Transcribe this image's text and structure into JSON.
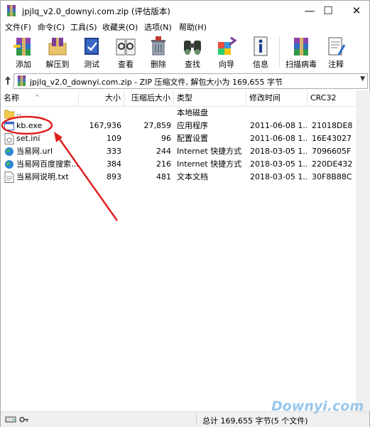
{
  "window": {
    "title": "jpjlq_v2.0_downyi.com.zip (评估版本)"
  },
  "menu": [
    "文件(F)",
    "命令(C)",
    "工具(S)",
    "收藏夹(O)",
    "选项(N)",
    "帮助(H)"
  ],
  "toolbar": [
    {
      "label": "添加",
      "icon": "add-archive-icon"
    },
    {
      "label": "解压到",
      "icon": "extract-to-icon"
    },
    {
      "label": "测试",
      "icon": "test-icon"
    },
    {
      "label": "查看",
      "icon": "view-icon"
    },
    {
      "label": "删除",
      "icon": "delete-icon"
    },
    {
      "label": "查找",
      "icon": "find-icon"
    },
    {
      "label": "向导",
      "icon": "wizard-icon"
    },
    {
      "label": "信息",
      "icon": "info-icon"
    },
    {
      "label": "扫描病毒",
      "icon": "scan-virus-icon"
    },
    {
      "label": "注释",
      "icon": "comment-icon"
    }
  ],
  "address": {
    "text": "jpjlq_v2.0_downyi.com.zip - ZIP 压缩文件, 解包大小为 169,655 字节"
  },
  "columns": {
    "name": "名称",
    "size": "大小",
    "packed": "压缩后大小",
    "type": "类型",
    "modified": "修改时间",
    "crc": "CRC32"
  },
  "files": [
    {
      "name": "..",
      "size": "",
      "packed": "",
      "type": "本地磁盘",
      "modified": "",
      "crc": "",
      "icon": "folder-icon"
    },
    {
      "name": "kb.exe",
      "size": "167,936",
      "packed": "27,859",
      "type": "应用程序",
      "modified": "2011-06-08 1...",
      "crc": "21018DE8",
      "icon": "exe-file-icon"
    },
    {
      "name": "set.ini",
      "size": "109",
      "packed": "96",
      "type": "配置设置",
      "modified": "2011-06-08 1...",
      "crc": "16E43027",
      "icon": "ini-file-icon"
    },
    {
      "name": "当易网.url",
      "size": "333",
      "packed": "244",
      "type": "Internet 快捷方式",
      "modified": "2018-03-05 1...",
      "crc": "7096605F",
      "icon": "url-file-icon"
    },
    {
      "name": "当易网百度搜索...",
      "size": "384",
      "packed": "216",
      "type": "Internet 快捷方式",
      "modified": "2018-03-05 1...",
      "crc": "220DE432",
      "icon": "url-file-icon"
    },
    {
      "name": "当易网说明.txt",
      "size": "893",
      "packed": "481",
      "type": "文本文档",
      "modified": "2018-03-05 1...",
      "crc": "30F8B88C",
      "icon": "txt-file-icon"
    }
  ],
  "status": {
    "text": "总计 169,655 字节(5 个文件)"
  },
  "watermark": "Downyi.com",
  "colors": {
    "annotation": "#e02020",
    "selection_accent": "#0078d7"
  }
}
